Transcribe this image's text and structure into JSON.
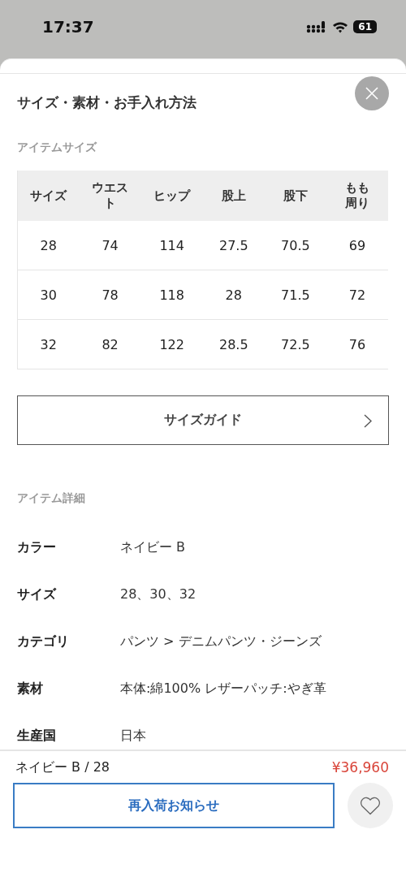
{
  "status_bar": {
    "time": "17:37",
    "battery": "61"
  },
  "sheet": {
    "title": "サイズ・素材・お手入れ方法"
  },
  "size_section": {
    "heading": "アイテムサイズ",
    "columns": [
      "サイズ",
      "ウエスト",
      "ヒップ",
      "股上",
      "股下",
      "もも周り"
    ],
    "rows": [
      [
        "28",
        "74",
        "114",
        "27.5",
        "70.5",
        "69"
      ],
      [
        "30",
        "78",
        "118",
        "28",
        "71.5",
        "72"
      ],
      [
        "32",
        "82",
        "122",
        "28.5",
        "72.5",
        "76"
      ]
    ],
    "guide_button": "サイズガイド"
  },
  "detail_section": {
    "heading": "アイテム詳細",
    "rows": [
      {
        "label": "カラー",
        "value": "ネイビー B"
      },
      {
        "label": "サイズ",
        "value": "28、30、32"
      },
      {
        "label": "カテゴリ",
        "value": "パンツ > デニムパンツ・ジーンズ"
      },
      {
        "label": "素材",
        "value": "本体:綿100% レザーパッチ:やぎ革"
      },
      {
        "label": "生産国",
        "value": "日本"
      }
    ]
  },
  "footer": {
    "variant": "ネイビー B / 28",
    "price": "¥36,960",
    "notify_button": "再入荷お知らせ"
  }
}
